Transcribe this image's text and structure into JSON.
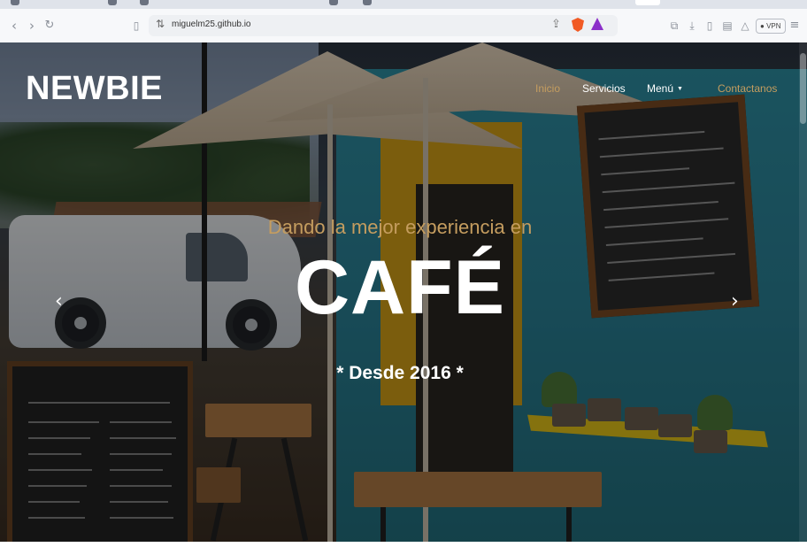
{
  "browser": {
    "url": "miguelm25.github.io",
    "vpn_label": "VPN"
  },
  "site": {
    "brand": "NEWBIE",
    "nav": [
      {
        "label": "Inicio"
      },
      {
        "label": "Servicios"
      },
      {
        "label": "Menú"
      },
      {
        "label": "Contactanos"
      }
    ]
  },
  "hero": {
    "tagline": "Dando la mejor experiencia en",
    "headline": "CAFÉ",
    "since": "* Desde 2016 *",
    "prev_arrow": "‹",
    "next_arrow": "›"
  },
  "colors": {
    "accent": "#c59d5f",
    "nav_text": "#ffffff"
  }
}
